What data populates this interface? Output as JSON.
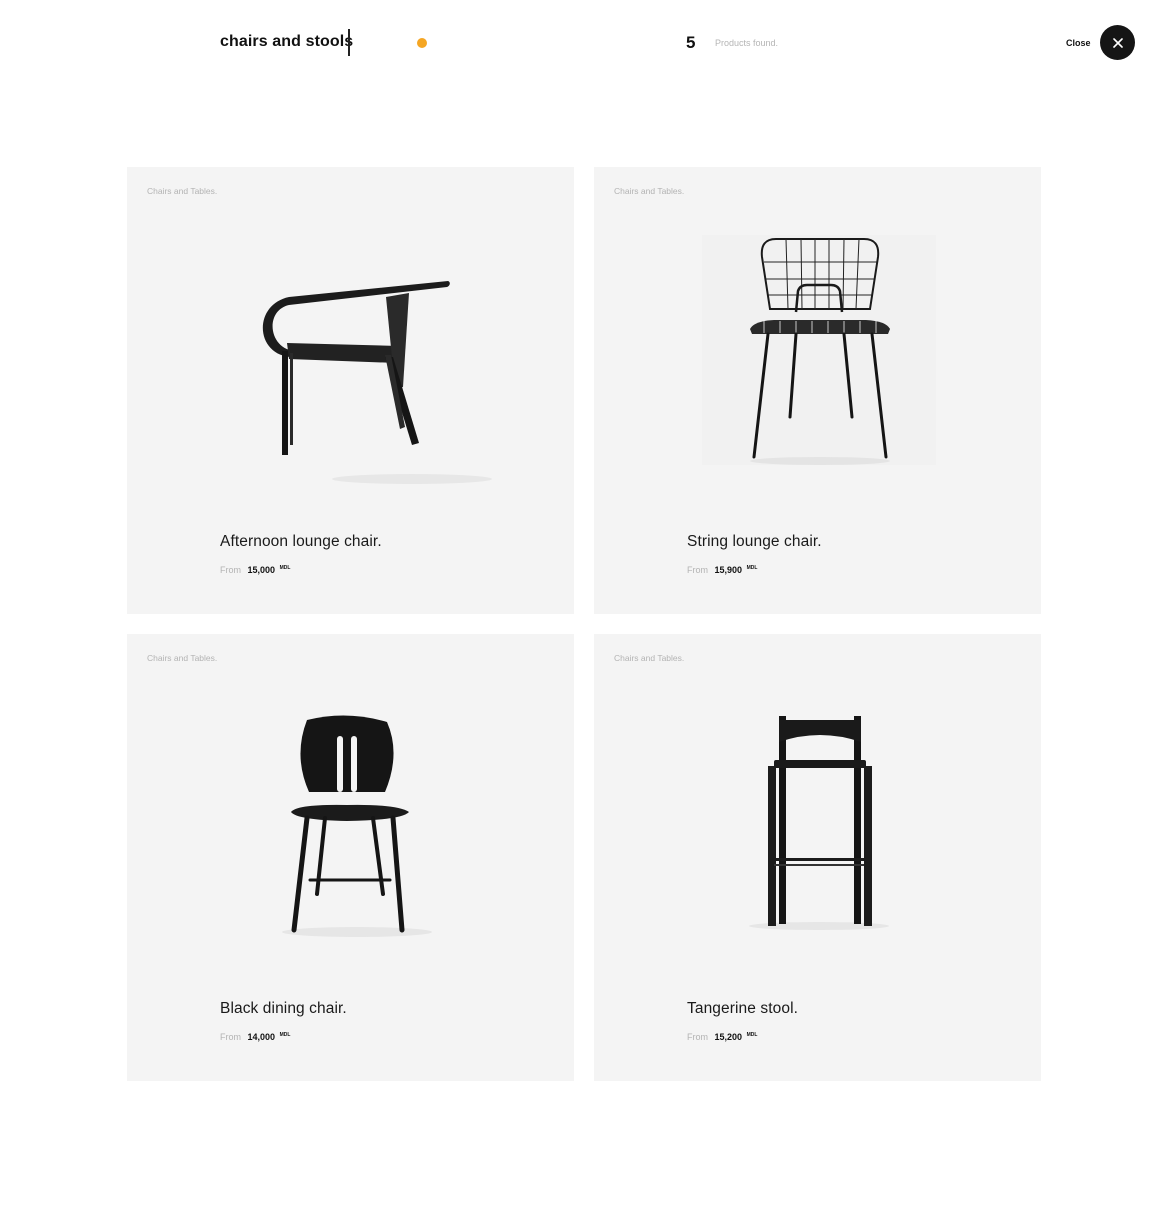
{
  "header": {
    "search_query": "chairs and stools",
    "results_count": "5",
    "results_label": "Products found.",
    "close_label": "Close",
    "accent_color": "#f5a623"
  },
  "products": [
    {
      "category": "Chairs and Tables.",
      "name": "Afternoon lounge chair.",
      "price_prefix": "From",
      "price": "15,000",
      "currency": "MDL",
      "icon": "lounge-chair"
    },
    {
      "category": "Chairs and Tables.",
      "name": "String lounge chair.",
      "price_prefix": "From",
      "price": "15,900",
      "currency": "MDL",
      "icon": "wire-chair"
    },
    {
      "category": "Chairs and Tables.",
      "name": "Black dining chair.",
      "price_prefix": "From",
      "price": "14,000",
      "currency": "MDL",
      "icon": "dining-chair"
    },
    {
      "category": "Chairs and Tables.",
      "name": "Tangerine stool.",
      "price_prefix": "From",
      "price": "15,200",
      "currency": "MDL",
      "icon": "bar-stool"
    }
  ]
}
